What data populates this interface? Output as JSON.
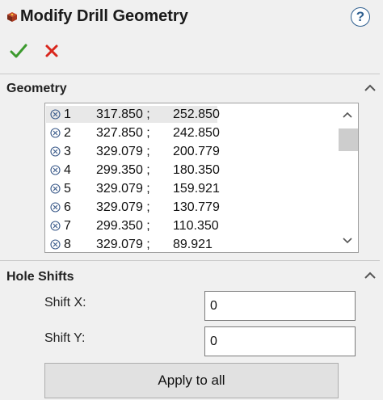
{
  "window": {
    "title": "Modify Drill Geometry",
    "help_label": "?"
  },
  "toolbar": {
    "ok_icon": "check-icon",
    "cancel_icon": "close-icon",
    "ok_color": "#3c9a2e",
    "cancel_color": "#d9261c"
  },
  "geometry": {
    "title": "Geometry",
    "rows": [
      {
        "num": "1",
        "x": "317.850 ;",
        "y": "252.850"
      },
      {
        "num": "2",
        "x": "327.850 ;",
        "y": "242.850"
      },
      {
        "num": "3",
        "x": "329.079 ;",
        "y": "200.779"
      },
      {
        "num": "4",
        "x": "299.350 ;",
        "y": "180.350"
      },
      {
        "num": "5",
        "x": "329.079 ;",
        "y": "159.921"
      },
      {
        "num": "6",
        "x": "329.079 ;",
        "y": "130.779"
      },
      {
        "num": "7",
        "x": "299.350 ;",
        "y": "110.350"
      },
      {
        "num": "8",
        "x": "329.079 ;",
        "y": "89.921"
      }
    ]
  },
  "hole_shifts": {
    "title": "Hole Shifts",
    "shift_x_label": "Shift X:",
    "shift_x_value": "0",
    "shift_y_label": "Shift Y:",
    "shift_y_value": "0",
    "apply_label": "Apply to all"
  }
}
